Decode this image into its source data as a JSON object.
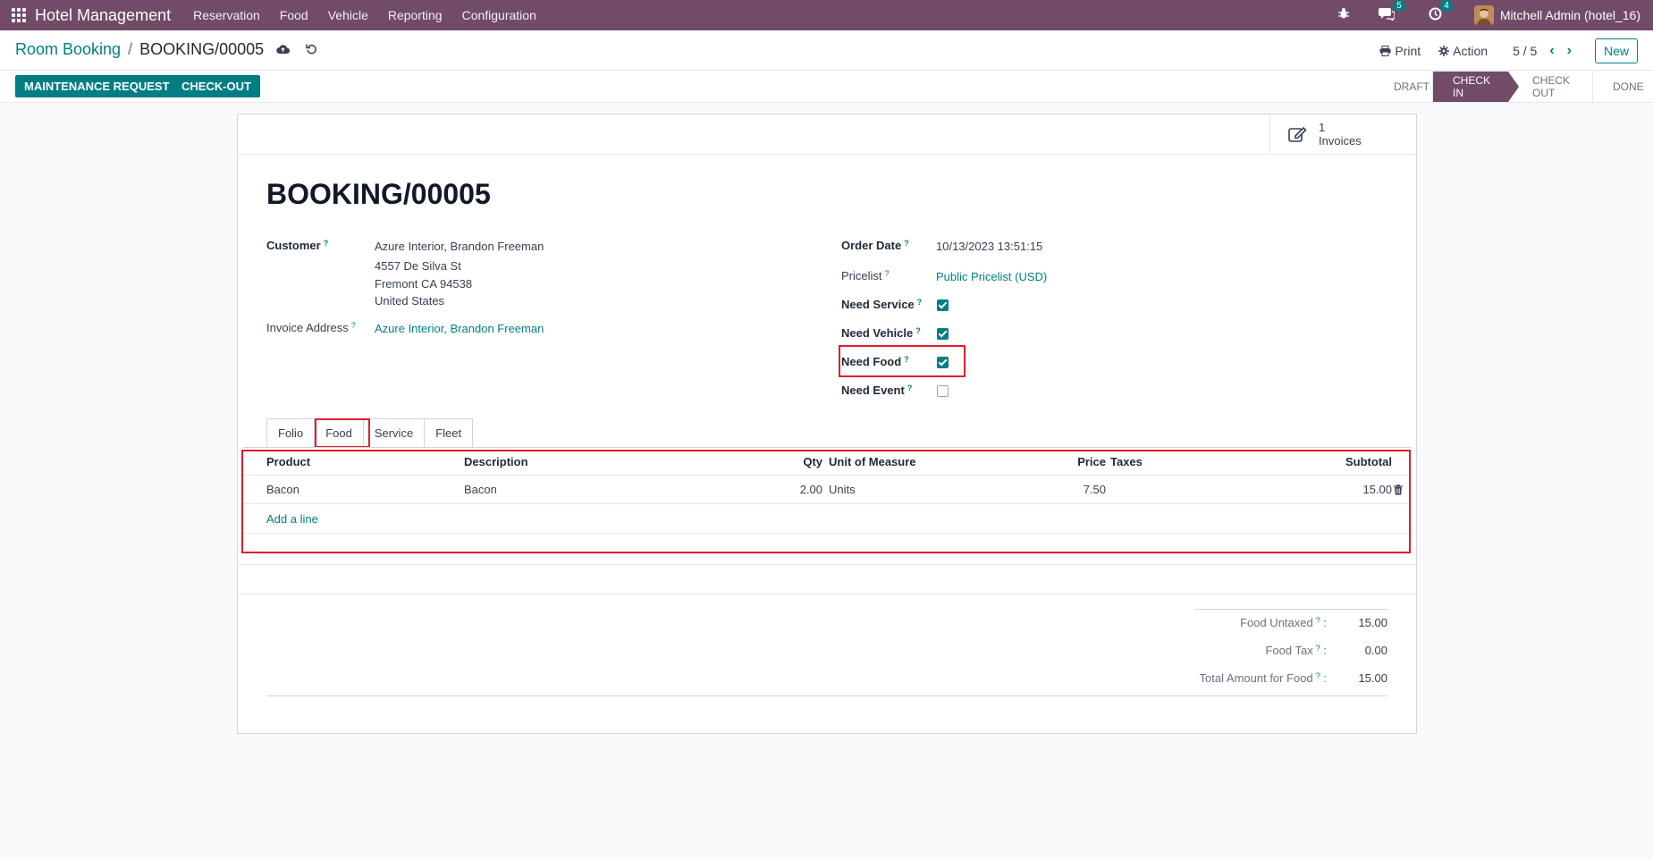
{
  "navbar": {
    "brand": "Hotel Management",
    "menu": [
      "Reservation",
      "Food",
      "Vehicle",
      "Reporting",
      "Configuration"
    ],
    "messages_badge": "5",
    "activities_badge": "4",
    "user": "Mitchell Admin (hotel_16)"
  },
  "control_panel": {
    "breadcrumb_parent": "Room Booking",
    "breadcrumb_sep": "/",
    "breadcrumb_current": "BOOKING/00005",
    "print_label": "Print",
    "action_label": "Action",
    "pager": "5 / 5",
    "new_label": "New"
  },
  "statusbar": {
    "buttons": [
      "MAINTENANCE REQUEST",
      "CHECK-OUT"
    ],
    "stages": [
      "DRAFT",
      "CHECK IN",
      "CHECK OUT",
      "DONE"
    ],
    "active_stage": "CHECK IN"
  },
  "smart_button": {
    "count": "1",
    "label": "Invoices"
  },
  "record": {
    "title": "BOOKING/00005",
    "customer_label": "Customer",
    "customer_name": "Azure Interior, Brandon Freeman",
    "customer_street": "4557 De Silva St",
    "customer_city": "Fremont CA 94538",
    "customer_country": "United States",
    "invoice_address_label": "Invoice Address",
    "invoice_address": "Azure Interior, Brandon Freeman",
    "order_date_label": "Order Date",
    "order_date": "10/13/2023 13:51:15",
    "pricelist_label": "Pricelist",
    "pricelist": "Public Pricelist (USD)",
    "need_service_label": "Need Service",
    "need_vehicle_label": "Need Vehicle",
    "need_food_label": "Need Food",
    "need_event_label": "Need Event",
    "qmark": "?"
  },
  "flags": {
    "need_service": true,
    "need_vehicle": true,
    "need_food": true,
    "need_event": false
  },
  "tabs": [
    "Folio",
    "Food",
    "Service",
    "Fleet"
  ],
  "active_tab": "Food",
  "food_table": {
    "columns": {
      "product": "Product",
      "description": "Description",
      "qty": "Qty",
      "uom": "Unit of Measure",
      "price": "Price",
      "taxes": "Taxes",
      "subtotal": "Subtotal"
    },
    "rows": [
      {
        "product": "Bacon",
        "description": "Bacon",
        "qty": "2.00",
        "uom": "Units",
        "price": "7.50",
        "taxes": "",
        "subtotal": "15.00"
      }
    ],
    "add_line": "Add a line"
  },
  "totals": {
    "food_untaxed_label": "Food Untaxed",
    "food_untaxed": "15.00",
    "food_tax_label": "Food Tax",
    "food_tax": "0.00",
    "total_label": "Total Amount for Food",
    "total": "15.00",
    "suffix": ":"
  },
  "colors": {
    "brand": "#714b67",
    "accent": "#017e84",
    "highlight": "#e11d2a"
  }
}
